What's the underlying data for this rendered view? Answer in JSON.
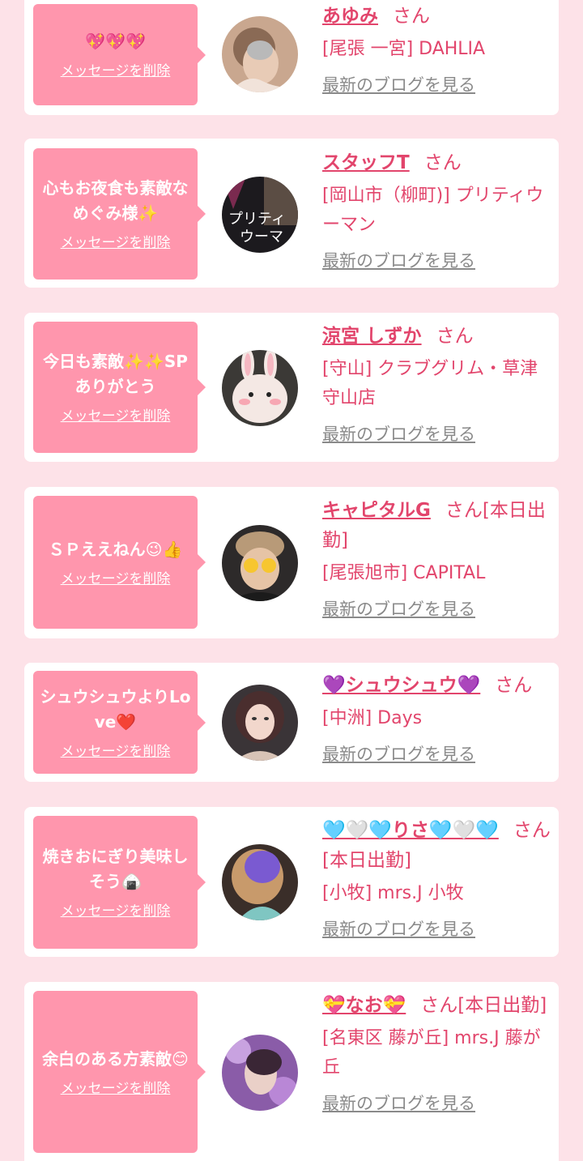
{
  "cards": [
    {
      "message": "💖💖💖",
      "delete_label": "メッセージを削除",
      "name": "あゆみ",
      "honorific": "さん",
      "shop": "[尾張 一宮] DAHLIA",
      "blog_label": "最新のブログを見る"
    },
    {
      "message": "心もお夜食も素敵なめぐみ様✨",
      "delete_label": "メッセージを削除",
      "name": "スタッフT",
      "honorific": "さん",
      "shop": "[岡山市（柳町)] プリティウーマン",
      "blog_label": "最新のブログを見る"
    },
    {
      "message": "今日も素敵✨✨SPありがとう",
      "delete_label": "メッセージを削除",
      "name": "涼宮 しずか",
      "honorific": "さん",
      "shop": "[守山] クラブグリム・草津守山店",
      "blog_label": "最新のブログを見る"
    },
    {
      "message": "ＳＰええねん😉👍",
      "delete_label": "メッセージを削除",
      "name": "キャピタルG",
      "honorific": "さん[本日出勤]",
      "shop": "[尾張旭市] CAPITAL",
      "blog_label": "最新のブログを見る"
    },
    {
      "message": "シュウシュウよりLove❤️",
      "delete_label": "メッセージを削除",
      "name": "💜シュウシュウ💜",
      "honorific": "さん",
      "shop": "[中洲] Days",
      "blog_label": "最新のブログを見る"
    },
    {
      "message": "焼きおにぎり美味しそう🍙",
      "delete_label": "メッセージを削除",
      "name": "🩵🤍🩵りさ🩵🤍🩵",
      "honorific": "さん[本日出勤]",
      "shop": "[小牧] mrs.J 小牧",
      "blog_label": "最新のブログを見る"
    },
    {
      "message": "余白のある方素敵😊",
      "delete_label": "メッセージを削除",
      "name": "💝なお💝",
      "honorific": "さん[本日出勤]",
      "shop": "[名東区 藤が丘] mrs.J 藤が丘",
      "blog_label": "最新のブログを見る"
    }
  ],
  "colors": {
    "background": "#fde2e8",
    "card": "#ffffff",
    "bubble": "#ff96ad",
    "name": "#e2456c",
    "blog_link": "#8a8a8a"
  },
  "icons": [
    "avatar-photo"
  ]
}
